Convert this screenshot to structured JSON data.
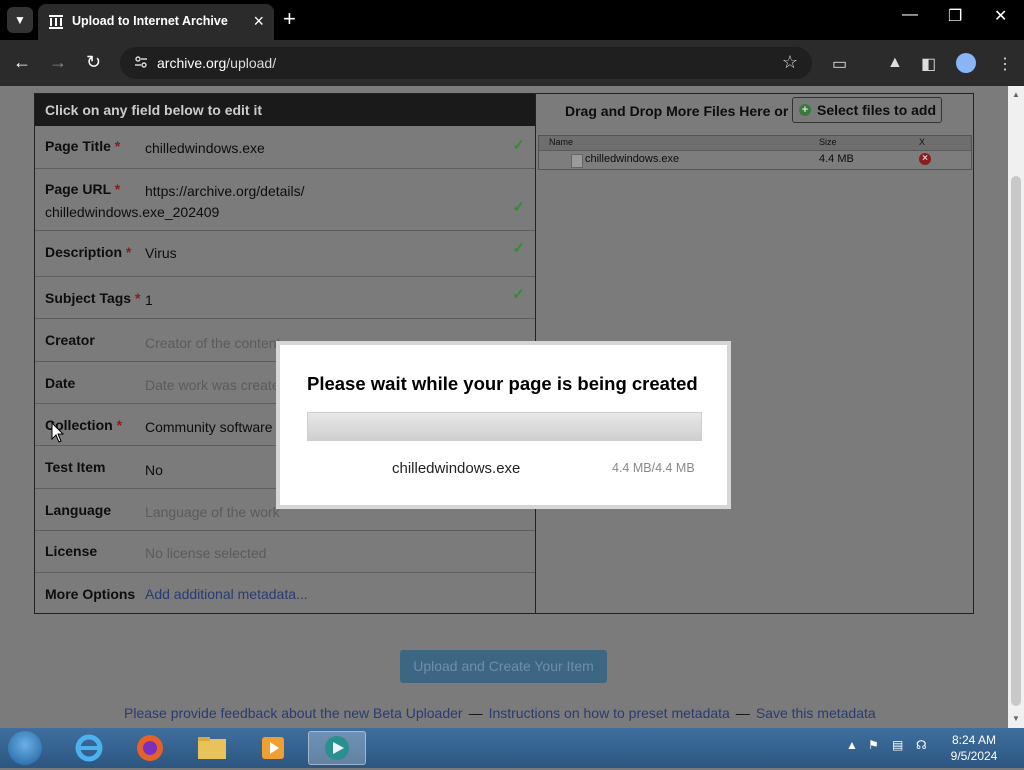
{
  "browser": {
    "tab_title": "Upload to Internet Archive",
    "url_domain": "archive.org",
    "url_path": "/upload/"
  },
  "form": {
    "header": "Click on any field below to edit it",
    "fields": [
      {
        "label": "Page Title",
        "required": "*",
        "value": "chilledwindows.exe",
        "placeholder": ""
      },
      {
        "label": "Page URL",
        "required": "*",
        "value": "https://archive.org/details/",
        "value2": "chilledwindows.exe_202409",
        "placeholder": ""
      },
      {
        "label": "Description",
        "required": "*",
        "value": "Virus",
        "placeholder": ""
      },
      {
        "label": "Subject Tags",
        "required": "*",
        "value": "1",
        "placeholder": ""
      },
      {
        "label": "Creator",
        "required": "",
        "value": "",
        "placeholder": "Creator of the content"
      },
      {
        "label": "Date",
        "required": "",
        "value": "",
        "placeholder": "Date work was created"
      },
      {
        "label": "Collection",
        "required": "*",
        "value": "Community software",
        "placeholder": ""
      },
      {
        "label": "Test Item",
        "required": "",
        "value": "No",
        "placeholder": ""
      },
      {
        "label": "Language",
        "required": "",
        "value": "",
        "placeholder": "Language of the work"
      },
      {
        "label": "License",
        "required": "",
        "value": "",
        "placeholder": "No license selected"
      },
      {
        "label": "More Options",
        "required": "",
        "value": "Add additional metadata...",
        "placeholder": ""
      }
    ]
  },
  "files": {
    "drag_text": "Drag and Drop More Files Here or",
    "select_button": "Select files to add",
    "columns": [
      "Name",
      "Size",
      "X"
    ],
    "rows": [
      {
        "name": "chilledwindows.exe",
        "size": "4.4 MB"
      }
    ]
  },
  "upload_button": "Upload and Create Your Item",
  "footer": {
    "feedback": "Please provide feedback about the new Beta Uploader",
    "instructions": "Instructions on how to preset metadata",
    "save": "Save this metadata",
    "sep": "—"
  },
  "modal": {
    "title": "Please wait while your page is being created",
    "filename": "chilledwindows.exe",
    "size": "4.4 MB/4.4 MB",
    "progress": 1.0
  },
  "taskbar": {
    "time": "8:24 AM",
    "date": "9/5/2024"
  },
  "colors": {
    "accent": "#3d6683",
    "check": "#2f8f2f",
    "link": "#2a3b72"
  }
}
